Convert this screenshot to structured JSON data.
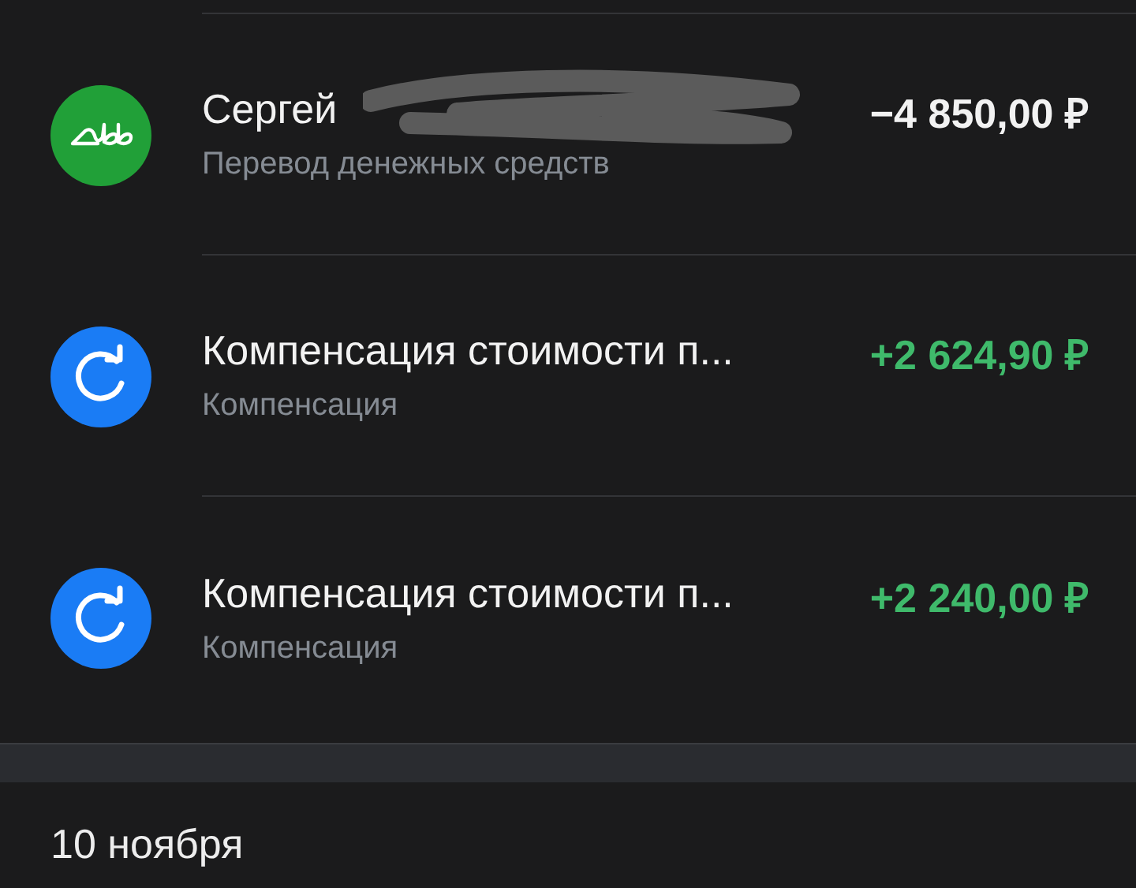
{
  "transactions": [
    {
      "kind": "bank",
      "title": "Сергей",
      "redacted": true,
      "subtitle": "Перевод денежных средств",
      "amount": "−4 850,00 ₽",
      "incoming": false
    },
    {
      "kind": "refund",
      "title": "Компенсация стоимости п...",
      "redacted": false,
      "subtitle": "Компенсация",
      "amount": "+2 624,90 ₽",
      "incoming": true
    },
    {
      "kind": "refund",
      "title": "Компенсация стоимости п...",
      "redacted": false,
      "subtitle": "Компенсация",
      "amount": "+2 240,00 ₽",
      "incoming": true
    }
  ],
  "date_header": "10 ноября"
}
